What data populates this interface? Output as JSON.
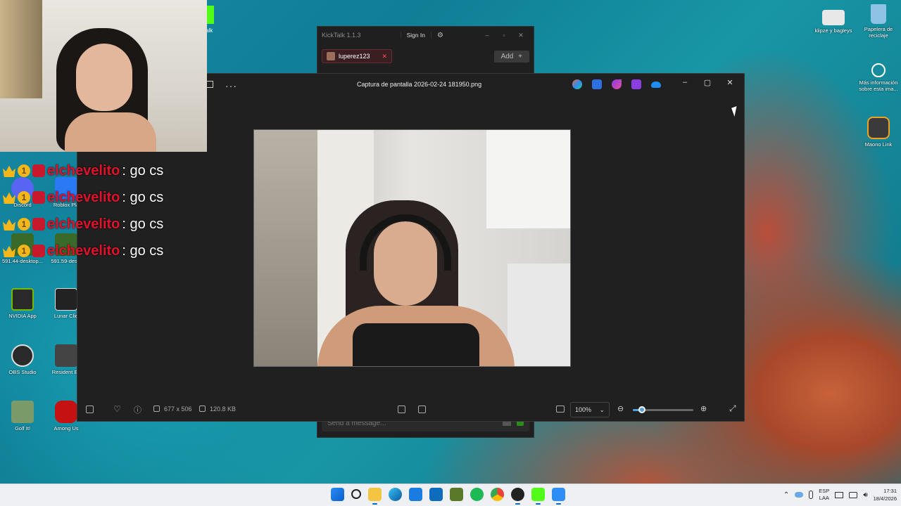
{
  "desktop": {
    "icons_left": [
      {
        "label": "Discord",
        "color": "#5865f2"
      },
      {
        "label": "Roblox Pla",
        "color": "#2a7af5"
      },
      {
        "label": "591.44-desktop...",
        "color": "#3a6a2a"
      },
      {
        "label": "591.59-deskt",
        "color": "#3a6a2a"
      },
      {
        "label": "NVIDIA App",
        "color": "#2a2a2a"
      },
      {
        "label": "Lunar Clie",
        "color": "#222222"
      },
      {
        "label": "OBS Studio",
        "color": "#2a2a2a"
      },
      {
        "label": "Resident Ev",
        "color": "#444444"
      },
      {
        "label": "Golf It!",
        "color": "#7a9a6a"
      },
      {
        "label": "Among Us",
        "color": "#c51111"
      }
    ],
    "icons_right": [
      {
        "label": "klipze y bagleys",
        "color": "#e8e8e8"
      },
      {
        "label": "Papelera de reciclaje",
        "color": "#8fc3e6"
      },
      {
        "label": "Más información sobre esta ima...",
        "color": "#ffffff"
      },
      {
        "label": "Maono Link",
        "color": "#3a3a3a"
      }
    ],
    "partial_label": "alk"
  },
  "chat_overlay": {
    "messages": [
      {
        "user": "elchevelito",
        "text": ": go cs"
      },
      {
        "user": "elchevelito",
        "text": ": go cs"
      },
      {
        "user": "elchevelito",
        "text": ": go cs"
      },
      {
        "user": "elchevelito",
        "text": ": go cs"
      }
    ],
    "badges": {
      "one": "1"
    }
  },
  "kicktalk": {
    "title": "KickTalk 1.1.3",
    "sign_in": "Sign In",
    "settings_icon": "gear-icon",
    "tab_label": "luperez123",
    "add_label": "Add",
    "add_icon": "+",
    "message_placeholder": "Send a message..."
  },
  "photo_viewer": {
    "title": "Captura de pantalla 2026-02-24 181950.png",
    "more_label": "···",
    "dimensions": "677 x 506",
    "file_size": "120.8 KB",
    "zoom": "100%",
    "zoom_level_fraction": 0.15,
    "taskbar_apps": [
      "copilot",
      "photos-edit",
      "clipchamp",
      "designer",
      "onedrive"
    ]
  },
  "taskbar": {
    "language": "ESP",
    "language_sub": "LAA",
    "time": "17:31",
    "date": "18/4/2026",
    "accent": "#0067c0"
  }
}
